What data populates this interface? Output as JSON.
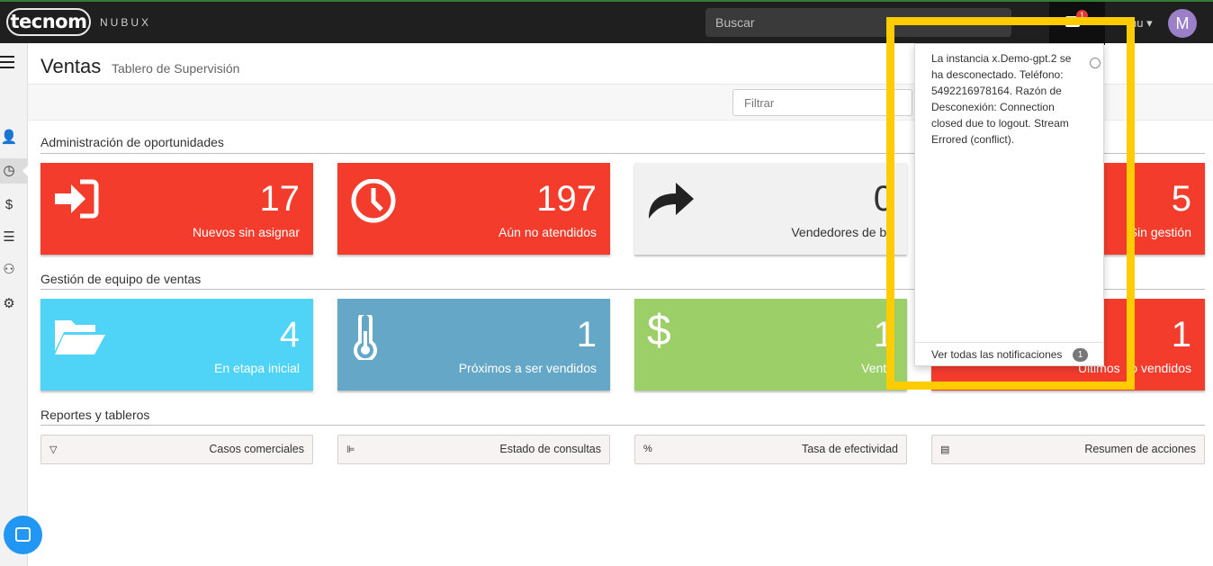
{
  "app": {
    "logo": "tecnom",
    "brand": "NUBUX"
  },
  "topbar": {
    "search_placeholder": "Buscar",
    "notification_count": "1",
    "menu_label": "nu",
    "avatar_initial": "M"
  },
  "page": {
    "title": "Ventas",
    "subtitle": "Tablero de Supervisión"
  },
  "filter": {
    "placeholder": "Filtrar"
  },
  "sections": {
    "oportunidades": {
      "title": "Administración de oportunidades",
      "cards": [
        {
          "value": "17",
          "label": "Nuevos sin asignar",
          "icon": "sign-in-icon",
          "color": "#f43c2c"
        },
        {
          "value": "197",
          "label": "Aún no atendidos",
          "icon": "clock-icon",
          "color": "#f43c2c"
        },
        {
          "value": "0",
          "label": "Vendedores de ba",
          "icon": "share-arrow-icon",
          "color": "#f1f1f1"
        },
        {
          "value": "5",
          "label": "Sin gestión",
          "icon": "none",
          "color": "#f43c2c"
        }
      ]
    },
    "equipo": {
      "title": "Gestión de equipo de ventas",
      "cards": [
        {
          "value": "4",
          "label": "En etapa inicial",
          "icon": "folder-open-icon",
          "color": "#4fd3f7"
        },
        {
          "value": "1",
          "label": "Próximos a ser vendidos",
          "icon": "thermometer-icon",
          "color": "#64a7c6"
        },
        {
          "value": "1",
          "label": "Venta",
          "icon": "dollar-icon",
          "color": "#9ccf67"
        },
        {
          "value": "1",
          "label": "Últimos   o vendidos",
          "icon": "none",
          "color": "#f43c2c"
        }
      ]
    },
    "reportes": {
      "title": "Reportes y tableros",
      "buttons": [
        {
          "label": "Casos comerciales",
          "icon": "filter-icon"
        },
        {
          "label": "Estado de consultas",
          "icon": "bar-chart-icon"
        },
        {
          "label": "Tasa de efectividad",
          "icon": "percent-icon"
        },
        {
          "label": "Resumen de acciones",
          "icon": "file-icon"
        }
      ]
    }
  },
  "notifications": {
    "message": "La instancia x.Demo-gpt.2 se ha desconectado. Teléfono: 5492216978164. Razón de Desconexión: Connection closed due to logout. Stream Errored (conflict).",
    "footer_label": "Ver todas las notificaciones",
    "footer_count": "1"
  },
  "colors": {
    "highlight": "#ffcc00",
    "topbar": "#1f1f1f",
    "accent_red": "#f43c2c"
  }
}
